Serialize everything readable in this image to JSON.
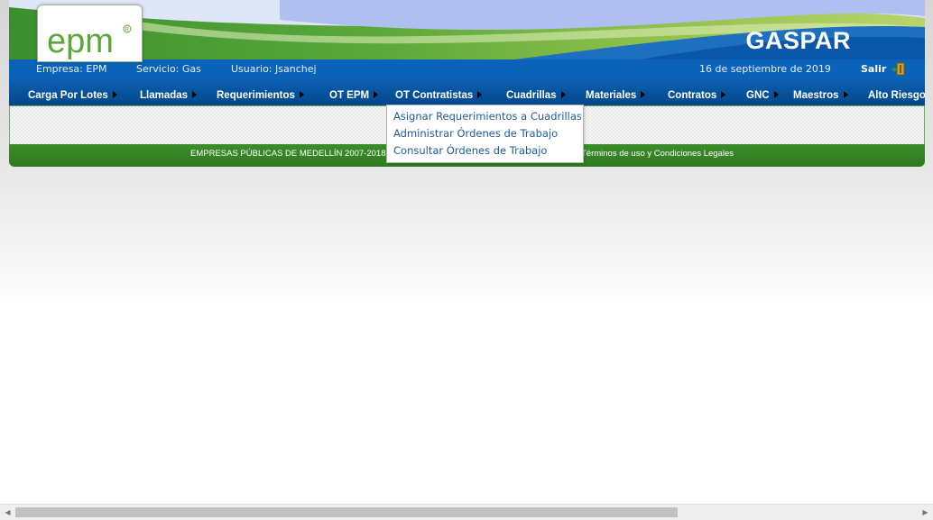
{
  "header": {
    "logo_text": "epm",
    "app_title": "GASPAR"
  },
  "info": {
    "empresa": "Empresa: EPM",
    "servicio": "Servicio: Gas",
    "usuario": "Usuario: Jsanchej",
    "fecha": "16 de septiembre de 2019",
    "salir": "Salir"
  },
  "menu": {
    "items": [
      {
        "label": "Carga Por Lotes"
      },
      {
        "label": "Llamadas"
      },
      {
        "label": "Requerimientos"
      },
      {
        "label": "OT EPM"
      },
      {
        "label": "OT Contratistas"
      },
      {
        "label": "Cuadrillas"
      },
      {
        "label": "Materiales"
      },
      {
        "label": "Contratos"
      },
      {
        "label": "GNC"
      },
      {
        "label": "Maestros"
      },
      {
        "label": "Alto Riesgo"
      }
    ]
  },
  "dropdown": {
    "items": [
      {
        "label": "Asignar Requerimientos a Cuadrillas"
      },
      {
        "label": "Administrar Órdenes de Trabajo"
      },
      {
        "label": "Consultar Órdenes de Trabajo"
      }
    ]
  },
  "footer": {
    "copyright": "EMPRESAS PÚBLICAS DE MEDELLÍN 2007-2018",
    "terms": "Términos de uso y Condiciones Legales"
  },
  "colors": {
    "brand_green": "#3b8f2e",
    "brand_blue": "#0a63b8",
    "link_blue": "#1f5a9c"
  }
}
